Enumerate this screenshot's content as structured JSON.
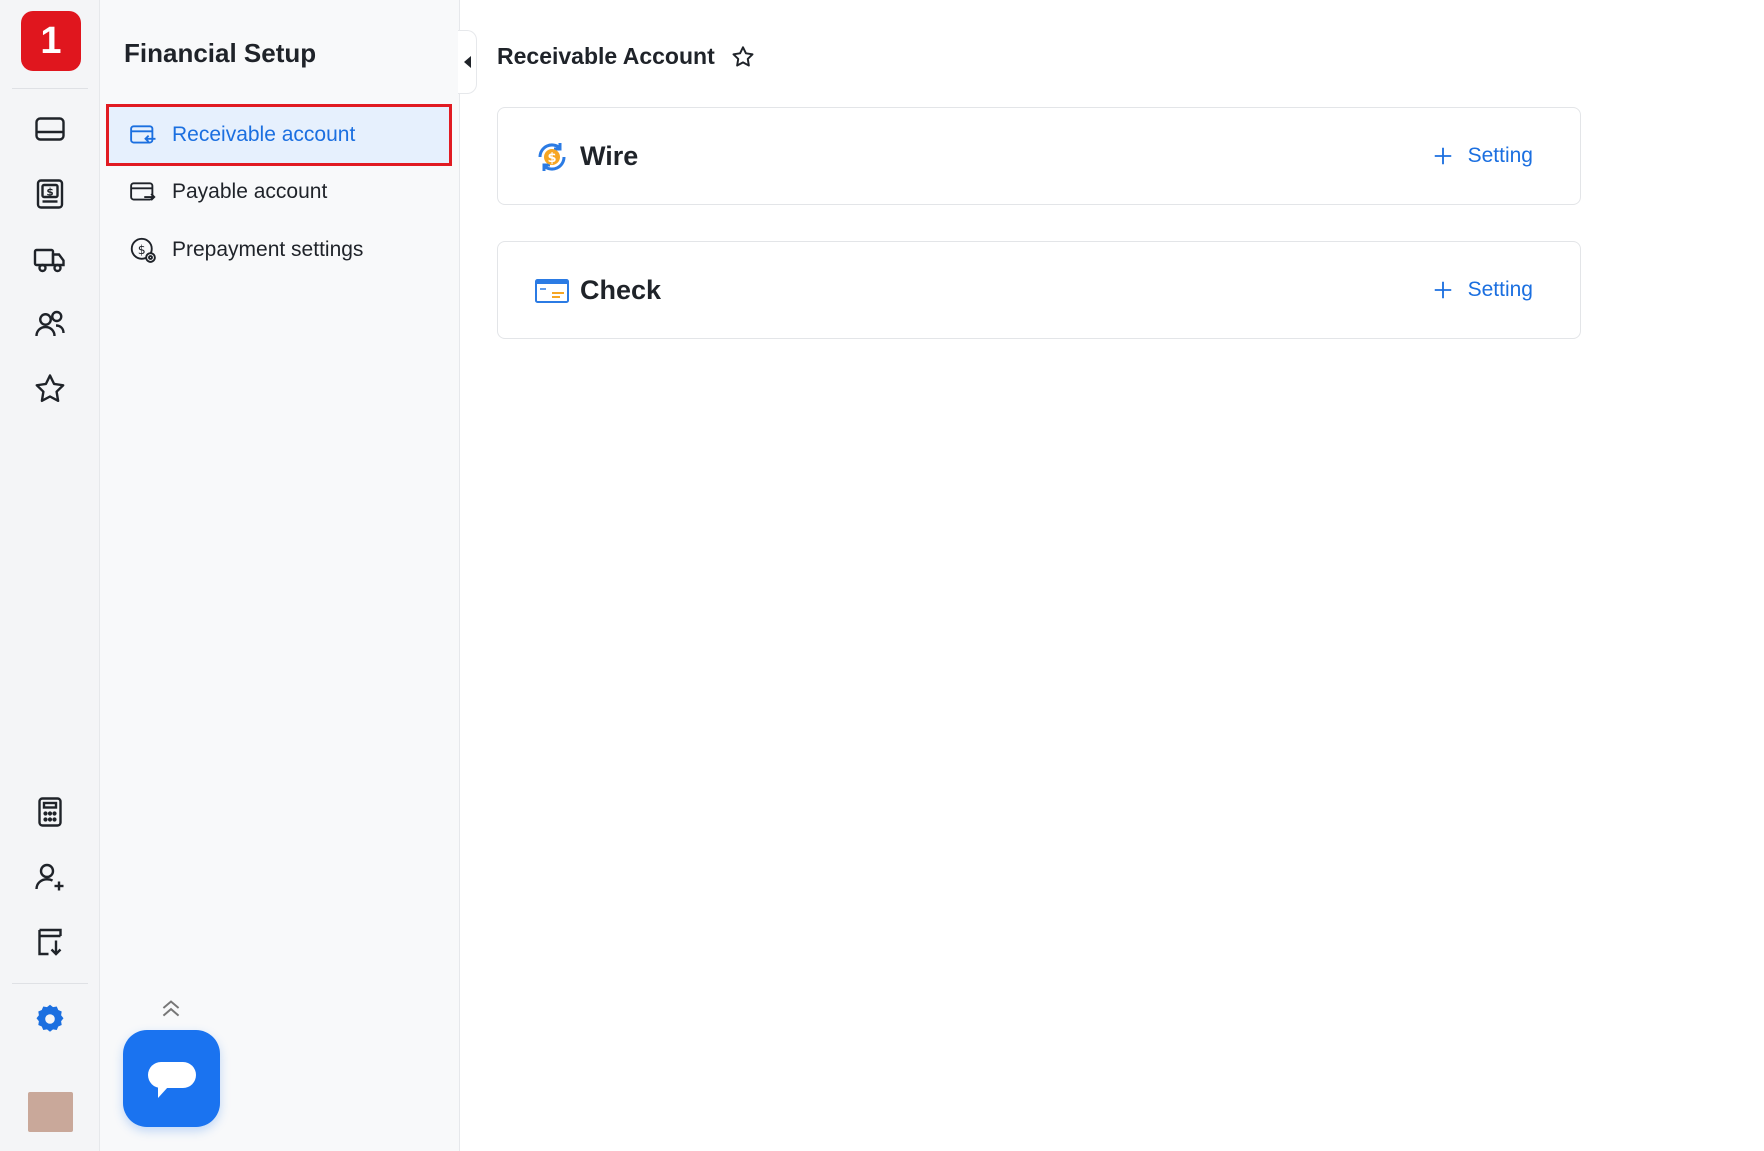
{
  "rail": {
    "logo": "1",
    "top_icons": [
      "card-icon",
      "dollar-doc-icon",
      "truck-icon",
      "users-icon",
      "star-icon"
    ],
    "bottom_icons": [
      "calculator-icon",
      "add-user-icon",
      "download-doc-icon",
      "settings-icon"
    ],
    "active_icon": "settings-icon"
  },
  "subnav": {
    "title": "Financial Setup",
    "items": [
      {
        "label": "Receivable account",
        "icon": "receivable-card-icon",
        "active": true
      },
      {
        "label": "Payable account",
        "icon": "payable-card-icon",
        "active": false
      },
      {
        "label": "Prepayment settings",
        "icon": "prepayment-coin-icon",
        "active": false
      }
    ]
  },
  "main": {
    "title": "Receivable Account",
    "cards": [
      {
        "title": "Wire",
        "icon": "wire-dollar-icon",
        "action": "Setting"
      },
      {
        "title": "Check",
        "icon": "check-card-icon",
        "action": "Setting"
      }
    ]
  },
  "colors": {
    "accent": "#1b6fe0",
    "brand": "#e0161e",
    "chat": "#1a73f0",
    "highlight_border": "#e11b22"
  }
}
